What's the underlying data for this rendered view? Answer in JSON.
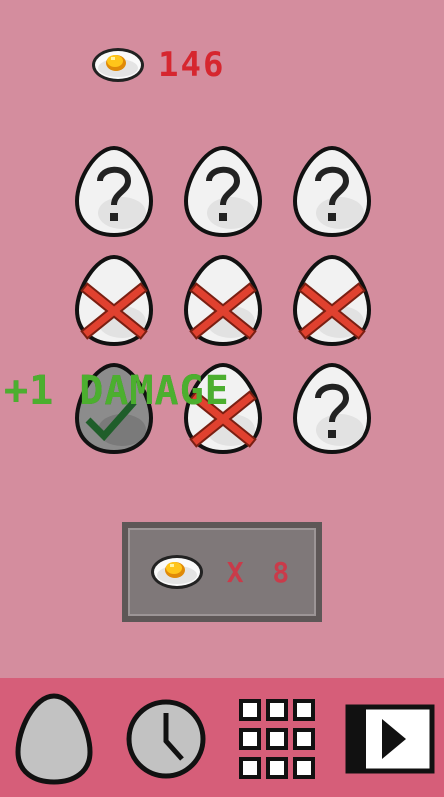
{
  "header": {
    "coin_count": "146",
    "coin_icon": "fried-egg-icon"
  },
  "eggs": [
    {
      "state": "unknown",
      "icon": "question-mark-icon"
    },
    {
      "state": "unknown",
      "icon": "question-mark-icon"
    },
    {
      "state": "unknown",
      "icon": "question-mark-icon"
    },
    {
      "state": "wrong",
      "icon": "red-x-icon"
    },
    {
      "state": "wrong",
      "icon": "red-x-icon"
    },
    {
      "state": "wrong",
      "icon": "red-x-icon"
    },
    {
      "state": "correct",
      "icon": "green-check-icon"
    },
    {
      "state": "wrong",
      "icon": "red-x-icon"
    },
    {
      "state": "unknown",
      "icon": "question-mark-icon"
    }
  ],
  "popup": {
    "text": "+1 DAMAGE",
    "color": "#4caf2f"
  },
  "reward": {
    "icon": "fried-egg-icon",
    "multiplier": "X 8"
  },
  "nav": {
    "items": [
      {
        "name": "egg-nav-icon"
      },
      {
        "name": "clock-nav-icon"
      },
      {
        "name": "grid-nav-icon"
      },
      {
        "name": "play-nav-icon"
      }
    ]
  },
  "colors": {
    "background": "#d48d9e",
    "bottom_bar": "#d65e79",
    "coin_text": "#d6262f",
    "cross": "#e0412f"
  }
}
